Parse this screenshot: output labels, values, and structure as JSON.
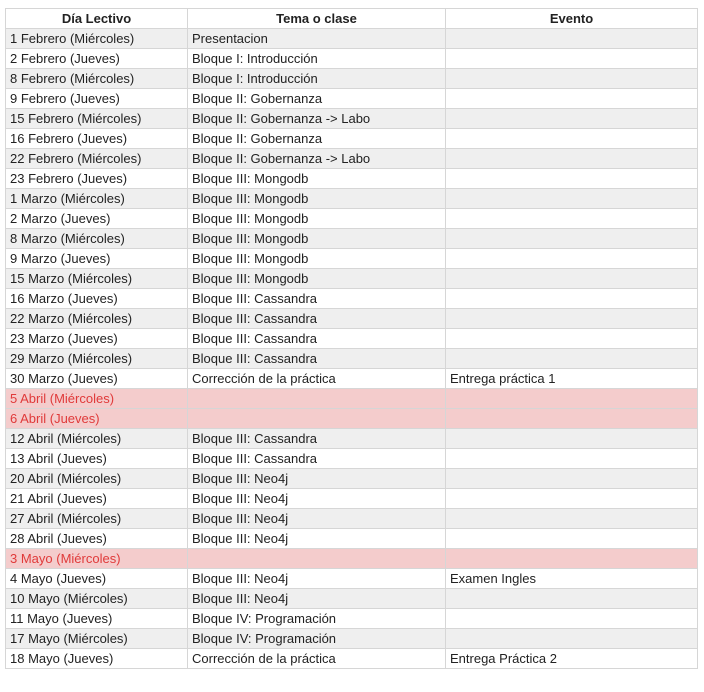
{
  "colors": {
    "grid": "#d6d6d6",
    "zebra": "#efefef",
    "holiday_bg": "#f4cccc",
    "holiday_text": "#e03a3a"
  },
  "headers": [
    "Día Lectivo",
    "Tema o clase",
    "Evento"
  ],
  "rows": [
    {
      "dia": "1 Febrero (Miércoles)",
      "tema": "Presentacion",
      "evento": "",
      "holiday": false
    },
    {
      "dia": "2 Febrero (Jueves)",
      "tema": "Bloque I: Introducción",
      "evento": "",
      "holiday": false
    },
    {
      "dia": "8 Febrero (Miércoles)",
      "tema": "Bloque I: Introducción",
      "evento": "",
      "holiday": false
    },
    {
      "dia": "9 Febrero (Jueves)",
      "tema": "Bloque II: Gobernanza",
      "evento": "",
      "holiday": false
    },
    {
      "dia": "15 Febrero (Miércoles)",
      "tema": "Bloque II: Gobernanza -> Labo",
      "evento": "",
      "holiday": false
    },
    {
      "dia": "16 Febrero (Jueves)",
      "tema": "Bloque II: Gobernanza",
      "evento": "",
      "holiday": false
    },
    {
      "dia": "22 Febrero (Miércoles)",
      "tema": "Bloque II: Gobernanza -> Labo",
      "evento": "",
      "holiday": false
    },
    {
      "dia": "23 Febrero (Jueves)",
      "tema": "Bloque III: Mongodb",
      "evento": "",
      "holiday": false
    },
    {
      "dia": "1 Marzo (Miércoles)",
      "tema": "Bloque III: Mongodb",
      "evento": "",
      "holiday": false
    },
    {
      "dia": "2 Marzo (Jueves)",
      "tema": "Bloque III: Mongodb",
      "evento": "",
      "holiday": false
    },
    {
      "dia": "8 Marzo (Miércoles)",
      "tema": "Bloque III: Mongodb",
      "evento": "",
      "holiday": false
    },
    {
      "dia": "9 Marzo (Jueves)",
      "tema": "Bloque III: Mongodb",
      "evento": "",
      "holiday": false
    },
    {
      "dia": "15 Marzo (Miércoles)",
      "tema": "Bloque III: Mongodb",
      "evento": "",
      "holiday": false
    },
    {
      "dia": "16 Marzo (Jueves)",
      "tema": "Bloque III: Cassandra",
      "evento": "",
      "holiday": false
    },
    {
      "dia": "22 Marzo (Miércoles)",
      "tema": "Bloque III: Cassandra",
      "evento": "",
      "holiday": false
    },
    {
      "dia": "23 Marzo (Jueves)",
      "tema": "Bloque III: Cassandra",
      "evento": "",
      "holiday": false
    },
    {
      "dia": "29 Marzo (Miércoles)",
      "tema": "Bloque III: Cassandra",
      "evento": "",
      "holiday": false
    },
    {
      "dia": "30 Marzo (Jueves)",
      "tema": "Corrección de la práctica",
      "evento": "Entrega práctica 1",
      "holiday": false
    },
    {
      "dia": "5 Abril (Miércoles)",
      "tema": "",
      "evento": "",
      "holiday": true
    },
    {
      "dia": "6 Abril (Jueves)",
      "tema": "",
      "evento": "",
      "holiday": true
    },
    {
      "dia": "12 Abril (Miércoles)",
      "tema": "Bloque III: Cassandra",
      "evento": "",
      "holiday": false
    },
    {
      "dia": "13 Abril (Jueves)",
      "tema": "Bloque III: Cassandra",
      "evento": "",
      "holiday": false
    },
    {
      "dia": "20 Abril (Miércoles)",
      "tema": "Bloque III: Neo4j",
      "evento": "",
      "holiday": false
    },
    {
      "dia": "21 Abril (Jueves)",
      "tema": "Bloque III: Neo4j",
      "evento": "",
      "holiday": false
    },
    {
      "dia": "27 Abril (Miércoles)",
      "tema": "Bloque III: Neo4j",
      "evento": "",
      "holiday": false
    },
    {
      "dia": "28 Abril (Jueves)",
      "tema": "Bloque III: Neo4j",
      "evento": "",
      "holiday": false
    },
    {
      "dia": "3 Mayo (Miércoles)",
      "tema": "",
      "evento": "",
      "holiday": true
    },
    {
      "dia": "4 Mayo (Jueves)",
      "tema": "Bloque III: Neo4j",
      "evento": "Examen Ingles",
      "holiday": false
    },
    {
      "dia": "10 Mayo (Miércoles)",
      "tema": "Bloque III: Neo4j",
      "evento": "",
      "holiday": false
    },
    {
      "dia": "11 Mayo (Jueves)",
      "tema": "Bloque IV: Programación",
      "evento": "",
      "holiday": false
    },
    {
      "dia": "17 Mayo (Miércoles)",
      "tema": "Bloque IV: Programación",
      "evento": "",
      "holiday": false
    },
    {
      "dia": "18 Mayo (Jueves)",
      "tema": "Corrección de la práctica",
      "evento": "Entrega Práctica 2",
      "holiday": false
    }
  ]
}
